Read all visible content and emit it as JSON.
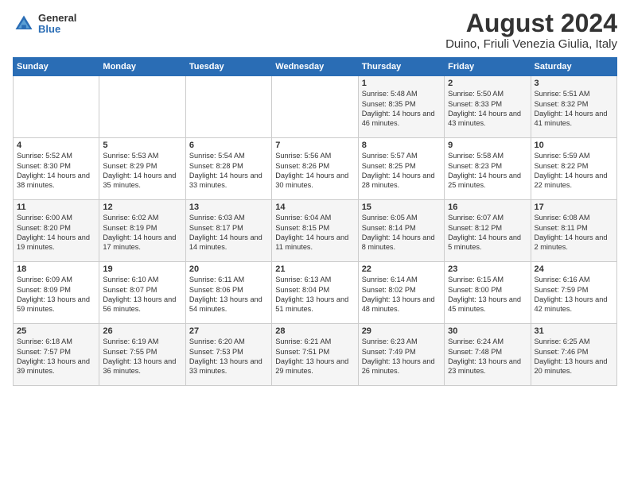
{
  "header": {
    "logo_general": "General",
    "logo_blue": "Blue",
    "title": "August 2024",
    "subtitle": "Duino, Friuli Venezia Giulia, Italy"
  },
  "calendar": {
    "days_of_week": [
      "Sunday",
      "Monday",
      "Tuesday",
      "Wednesday",
      "Thursday",
      "Friday",
      "Saturday"
    ],
    "weeks": [
      [
        {
          "day": "",
          "content": ""
        },
        {
          "day": "",
          "content": ""
        },
        {
          "day": "",
          "content": ""
        },
        {
          "day": "",
          "content": ""
        },
        {
          "day": "1",
          "content": "Sunrise: 5:48 AM\nSunset: 8:35 PM\nDaylight: 14 hours and 46 minutes."
        },
        {
          "day": "2",
          "content": "Sunrise: 5:50 AM\nSunset: 8:33 PM\nDaylight: 14 hours and 43 minutes."
        },
        {
          "day": "3",
          "content": "Sunrise: 5:51 AM\nSunset: 8:32 PM\nDaylight: 14 hours and 41 minutes."
        }
      ],
      [
        {
          "day": "4",
          "content": "Sunrise: 5:52 AM\nSunset: 8:30 PM\nDaylight: 14 hours and 38 minutes."
        },
        {
          "day": "5",
          "content": "Sunrise: 5:53 AM\nSunset: 8:29 PM\nDaylight: 14 hours and 35 minutes."
        },
        {
          "day": "6",
          "content": "Sunrise: 5:54 AM\nSunset: 8:28 PM\nDaylight: 14 hours and 33 minutes."
        },
        {
          "day": "7",
          "content": "Sunrise: 5:56 AM\nSunset: 8:26 PM\nDaylight: 14 hours and 30 minutes."
        },
        {
          "day": "8",
          "content": "Sunrise: 5:57 AM\nSunset: 8:25 PM\nDaylight: 14 hours and 28 minutes."
        },
        {
          "day": "9",
          "content": "Sunrise: 5:58 AM\nSunset: 8:23 PM\nDaylight: 14 hours and 25 minutes."
        },
        {
          "day": "10",
          "content": "Sunrise: 5:59 AM\nSunset: 8:22 PM\nDaylight: 14 hours and 22 minutes."
        }
      ],
      [
        {
          "day": "11",
          "content": "Sunrise: 6:00 AM\nSunset: 8:20 PM\nDaylight: 14 hours and 19 minutes."
        },
        {
          "day": "12",
          "content": "Sunrise: 6:02 AM\nSunset: 8:19 PM\nDaylight: 14 hours and 17 minutes."
        },
        {
          "day": "13",
          "content": "Sunrise: 6:03 AM\nSunset: 8:17 PM\nDaylight: 14 hours and 14 minutes."
        },
        {
          "day": "14",
          "content": "Sunrise: 6:04 AM\nSunset: 8:15 PM\nDaylight: 14 hours and 11 minutes."
        },
        {
          "day": "15",
          "content": "Sunrise: 6:05 AM\nSunset: 8:14 PM\nDaylight: 14 hours and 8 minutes."
        },
        {
          "day": "16",
          "content": "Sunrise: 6:07 AM\nSunset: 8:12 PM\nDaylight: 14 hours and 5 minutes."
        },
        {
          "day": "17",
          "content": "Sunrise: 6:08 AM\nSunset: 8:11 PM\nDaylight: 14 hours and 2 minutes."
        }
      ],
      [
        {
          "day": "18",
          "content": "Sunrise: 6:09 AM\nSunset: 8:09 PM\nDaylight: 13 hours and 59 minutes."
        },
        {
          "day": "19",
          "content": "Sunrise: 6:10 AM\nSunset: 8:07 PM\nDaylight: 13 hours and 56 minutes."
        },
        {
          "day": "20",
          "content": "Sunrise: 6:11 AM\nSunset: 8:06 PM\nDaylight: 13 hours and 54 minutes."
        },
        {
          "day": "21",
          "content": "Sunrise: 6:13 AM\nSunset: 8:04 PM\nDaylight: 13 hours and 51 minutes."
        },
        {
          "day": "22",
          "content": "Sunrise: 6:14 AM\nSunset: 8:02 PM\nDaylight: 13 hours and 48 minutes."
        },
        {
          "day": "23",
          "content": "Sunrise: 6:15 AM\nSunset: 8:00 PM\nDaylight: 13 hours and 45 minutes."
        },
        {
          "day": "24",
          "content": "Sunrise: 6:16 AM\nSunset: 7:59 PM\nDaylight: 13 hours and 42 minutes."
        }
      ],
      [
        {
          "day": "25",
          "content": "Sunrise: 6:18 AM\nSunset: 7:57 PM\nDaylight: 13 hours and 39 minutes."
        },
        {
          "day": "26",
          "content": "Sunrise: 6:19 AM\nSunset: 7:55 PM\nDaylight: 13 hours and 36 minutes."
        },
        {
          "day": "27",
          "content": "Sunrise: 6:20 AM\nSunset: 7:53 PM\nDaylight: 13 hours and 33 minutes."
        },
        {
          "day": "28",
          "content": "Sunrise: 6:21 AM\nSunset: 7:51 PM\nDaylight: 13 hours and 29 minutes."
        },
        {
          "day": "29",
          "content": "Sunrise: 6:23 AM\nSunset: 7:49 PM\nDaylight: 13 hours and 26 minutes."
        },
        {
          "day": "30",
          "content": "Sunrise: 6:24 AM\nSunset: 7:48 PM\nDaylight: 13 hours and 23 minutes."
        },
        {
          "day": "31",
          "content": "Sunrise: 6:25 AM\nSunset: 7:46 PM\nDaylight: 13 hours and 20 minutes."
        }
      ]
    ]
  }
}
